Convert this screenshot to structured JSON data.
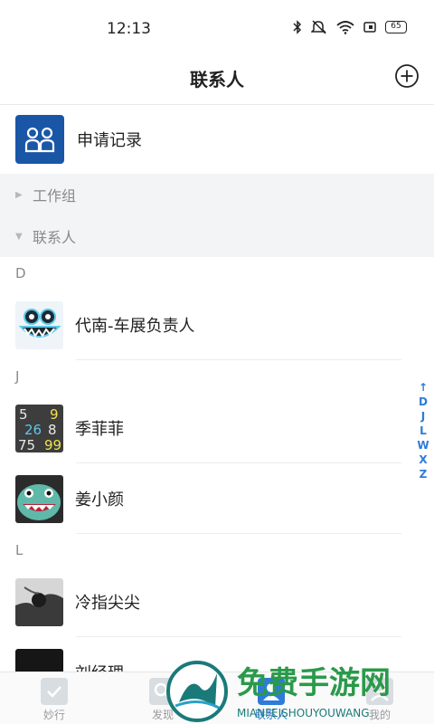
{
  "status_bar": {
    "time": "12:13",
    "battery": "65"
  },
  "header": {
    "title": "联系人"
  },
  "apply": {
    "label": "申请记录"
  },
  "groups": [
    {
      "label": "工作组",
      "expanded": false
    },
    {
      "label": "联系人",
      "expanded": true
    }
  ],
  "sections": [
    {
      "letter": "D",
      "contacts": [
        {
          "name": "代南-车展负责人",
          "avatar": "monster-avatar"
        }
      ]
    },
    {
      "letter": "J",
      "contacts": [
        {
          "name": "季菲菲",
          "avatar": "numbers-avatar"
        },
        {
          "name": "姜小颜",
          "avatar": "shark-avatar"
        }
      ]
    },
    {
      "letter": "L",
      "contacts": [
        {
          "name": "冷指尖尖",
          "avatar": "bw-photo-avatar"
        },
        {
          "name": "刘经理",
          "avatar": "dark-photo-avatar"
        }
      ]
    }
  ],
  "index_bar": [
    "↑",
    "D",
    "J",
    "L",
    "W",
    "X",
    "Z"
  ],
  "tabs": [
    {
      "label": "妙行"
    },
    {
      "label": "发现"
    },
    {
      "label": "联系人"
    },
    {
      "label": "我的"
    }
  ],
  "watermark": {
    "title": "免费手游网",
    "subtitle": "MIANFEISHOUYOUWANG"
  },
  "colors": {
    "accent": "#2e7bd8",
    "apply_icon_bg": "#1a56a6",
    "group_bg": "#f3f4f5"
  }
}
